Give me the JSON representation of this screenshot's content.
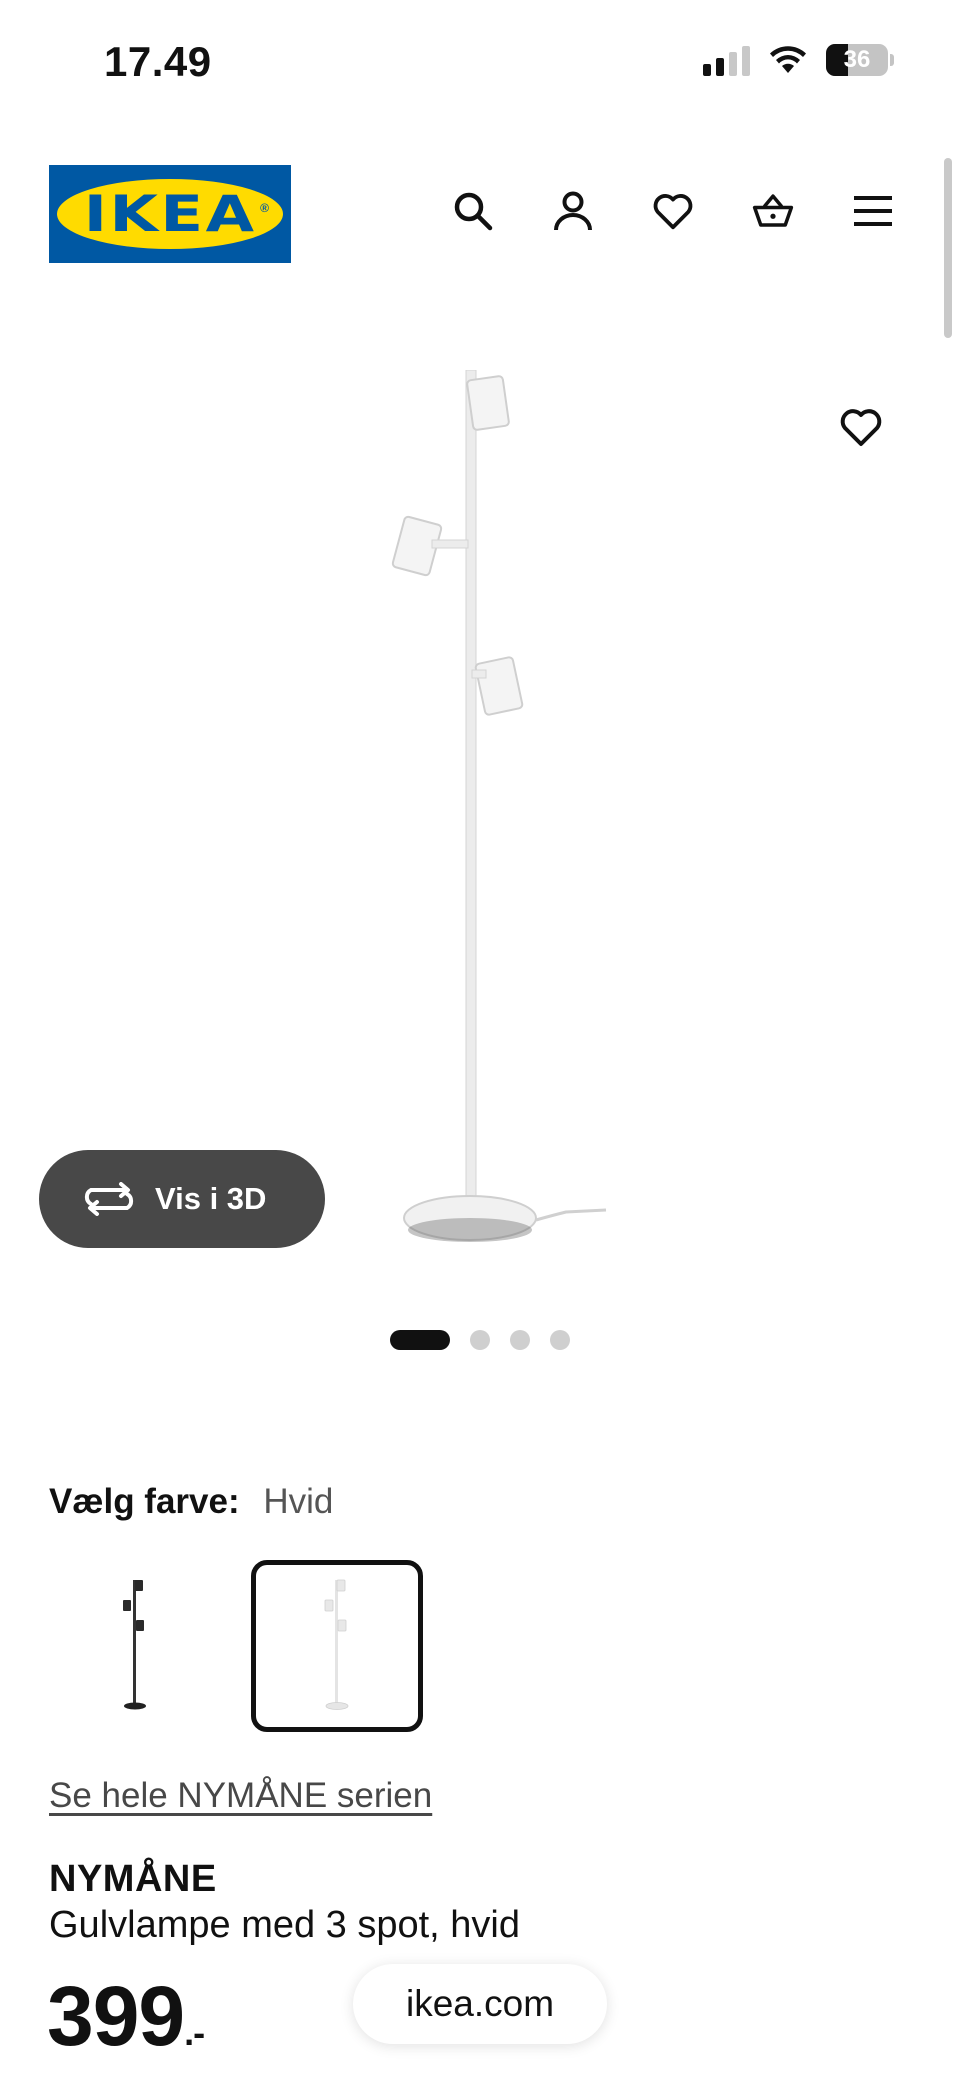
{
  "status_bar": {
    "time": "17.49",
    "battery_level": "36",
    "battery_percent": 36
  },
  "header": {
    "logo_text": "IKEA",
    "logo_registered": "®",
    "icons": [
      "search-icon",
      "account-icon",
      "heart-icon",
      "basket-icon",
      "menu-icon"
    ]
  },
  "gallery": {
    "view_3d_label": "Vis i 3D",
    "dot_count": 4,
    "active_dot": 1
  },
  "color_select": {
    "label": "Vælg farve:",
    "value": "Hvid",
    "options": [
      "sort",
      "hvid"
    ],
    "selected": "hvid"
  },
  "series_link": "Se hele NYMÅNE serien",
  "product": {
    "name": "NYMÅNE",
    "description": "Gulvlampe med 3 spot, hvid",
    "price": "399",
    "price_suffix": ".-"
  },
  "browser": {
    "url": "ikea.com"
  },
  "colors": {
    "ikea_blue": "#0058a3",
    "ikea_yellow": "#ffdb00",
    "button_dark": "#484848"
  }
}
